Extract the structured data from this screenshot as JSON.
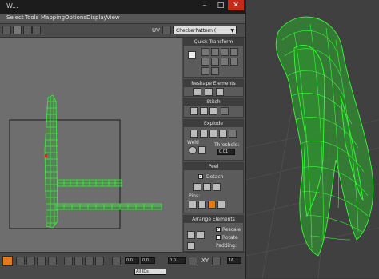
{
  "window": {
    "title": "W..."
  },
  "menu": {
    "items": [
      "Select",
      "Tools",
      "Mapping",
      "Options",
      "Display",
      "View"
    ]
  },
  "toolbar": {
    "uv_label": "UV",
    "map_dropdown": "CheckerPattern  ( Checker )"
  },
  "panel": {
    "quick_transform": "Quick Transform",
    "reshape_elements": "Reshape Elements",
    "stitch": "Stitch",
    "explode": "Explode",
    "weld": "Weld",
    "threshold_label": "Threshold:",
    "threshold_value": "0.01",
    "peel": "Peel",
    "detach": "Detach",
    "pins": "Pins:",
    "arrange_elements": "Arrange Elements",
    "rescale": "Rescale",
    "rotate": "Rotate",
    "padding": "Padding:",
    "detach_checked": true,
    "rescale_checked": true,
    "rotate_checked": false
  },
  "bottom": {
    "value1": "0.0",
    "value2": "0.0",
    "value3": "0.0",
    "zoom": "16",
    "ids_dropdown": "All IDs",
    "xy_label": "XY",
    "icons": [
      "snap-icon",
      "move-icon",
      "rotate-icon",
      "scale-icon",
      "freeform-icon",
      "mirror-icon",
      "lock-icon",
      "pan-icon",
      "zoom-icon"
    ]
  },
  "colors": {
    "mesh": "#34ff34",
    "uv_wire": "#39f039",
    "viewport_bg": "#6e6e6e",
    "accent": "#e07a1a"
  }
}
